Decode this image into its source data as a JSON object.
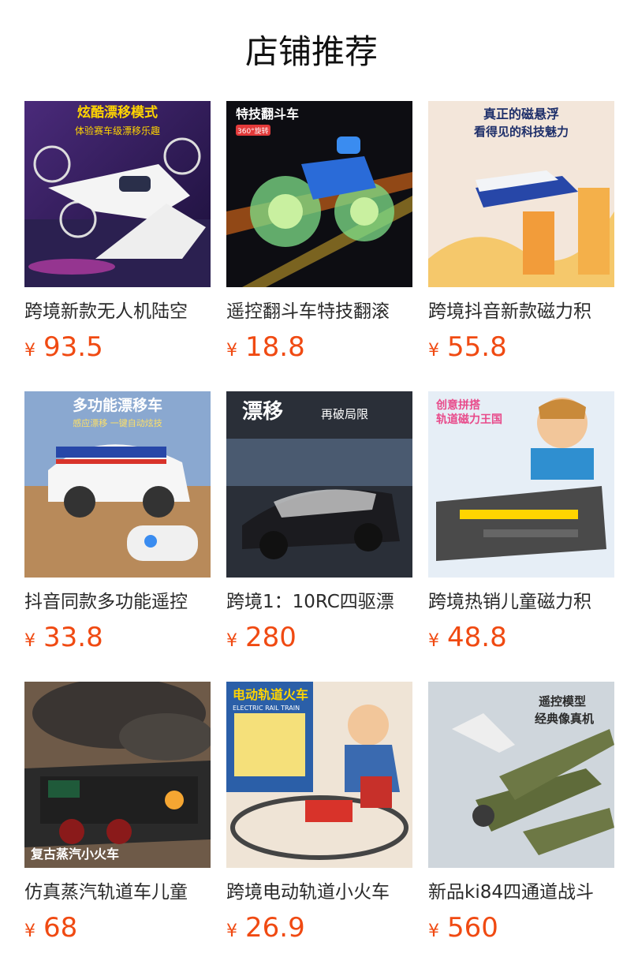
{
  "header": {
    "title": "店铺推荐"
  },
  "products": [
    {
      "name": "跨境新款无人机陆空",
      "currency": "¥",
      "price": "93.5",
      "banner": "炫酷漂移模式",
      "banner2": "体验赛车级漂移乐趣",
      "icon": "drone-car-image"
    },
    {
      "name": "遥控翻斗车特技翻滚",
      "currency": "¥",
      "price": "18.8",
      "banner": "特技翻斗车",
      "banner2": "360°旋转",
      "icon": "stunt-car-image"
    },
    {
      "name": "跨境抖音新款磁力积",
      "currency": "¥",
      "price": "55.8",
      "banner": "真正的磁悬浮",
      "banner2": "看得见的科技魅力",
      "icon": "maglev-train-image"
    },
    {
      "name": "抖音同款多功能遥控",
      "currency": "¥",
      "price": "33.8",
      "banner": "多功能漂移车",
      "banner2": "感应漂移 一键自动炫技",
      "icon": "drift-car-image"
    },
    {
      "name": "跨境1：10RC四驱漂",
      "currency": "¥",
      "price": "280",
      "banner": "漂移",
      "banner2": "再破局限",
      "icon": "rc-race-car-image"
    },
    {
      "name": "跨境热销儿童磁力积",
      "currency": "¥",
      "price": "48.8",
      "banner": "创意拼搭",
      "banner2": "轨道磁力王国",
      "icon": "magnetic-track-image"
    },
    {
      "name": "仿真蒸汽轨道车儿童",
      "currency": "¥",
      "price": "68",
      "banner": "复古蒸汽小火车",
      "banner2": "",
      "icon": "steam-train-image"
    },
    {
      "name": "跨境电动轨道小火车",
      "currency": "¥",
      "price": "26.9",
      "banner": "电动轨道火车",
      "banner2": "ELECTRIC RAIL TRAIN",
      "icon": "electric-train-image"
    },
    {
      "name": "新品ki84四通道战斗",
      "currency": "¥",
      "price": "560",
      "banner": "遥控模型",
      "banner2": "经典像真机",
      "icon": "warplane-image"
    }
  ]
}
